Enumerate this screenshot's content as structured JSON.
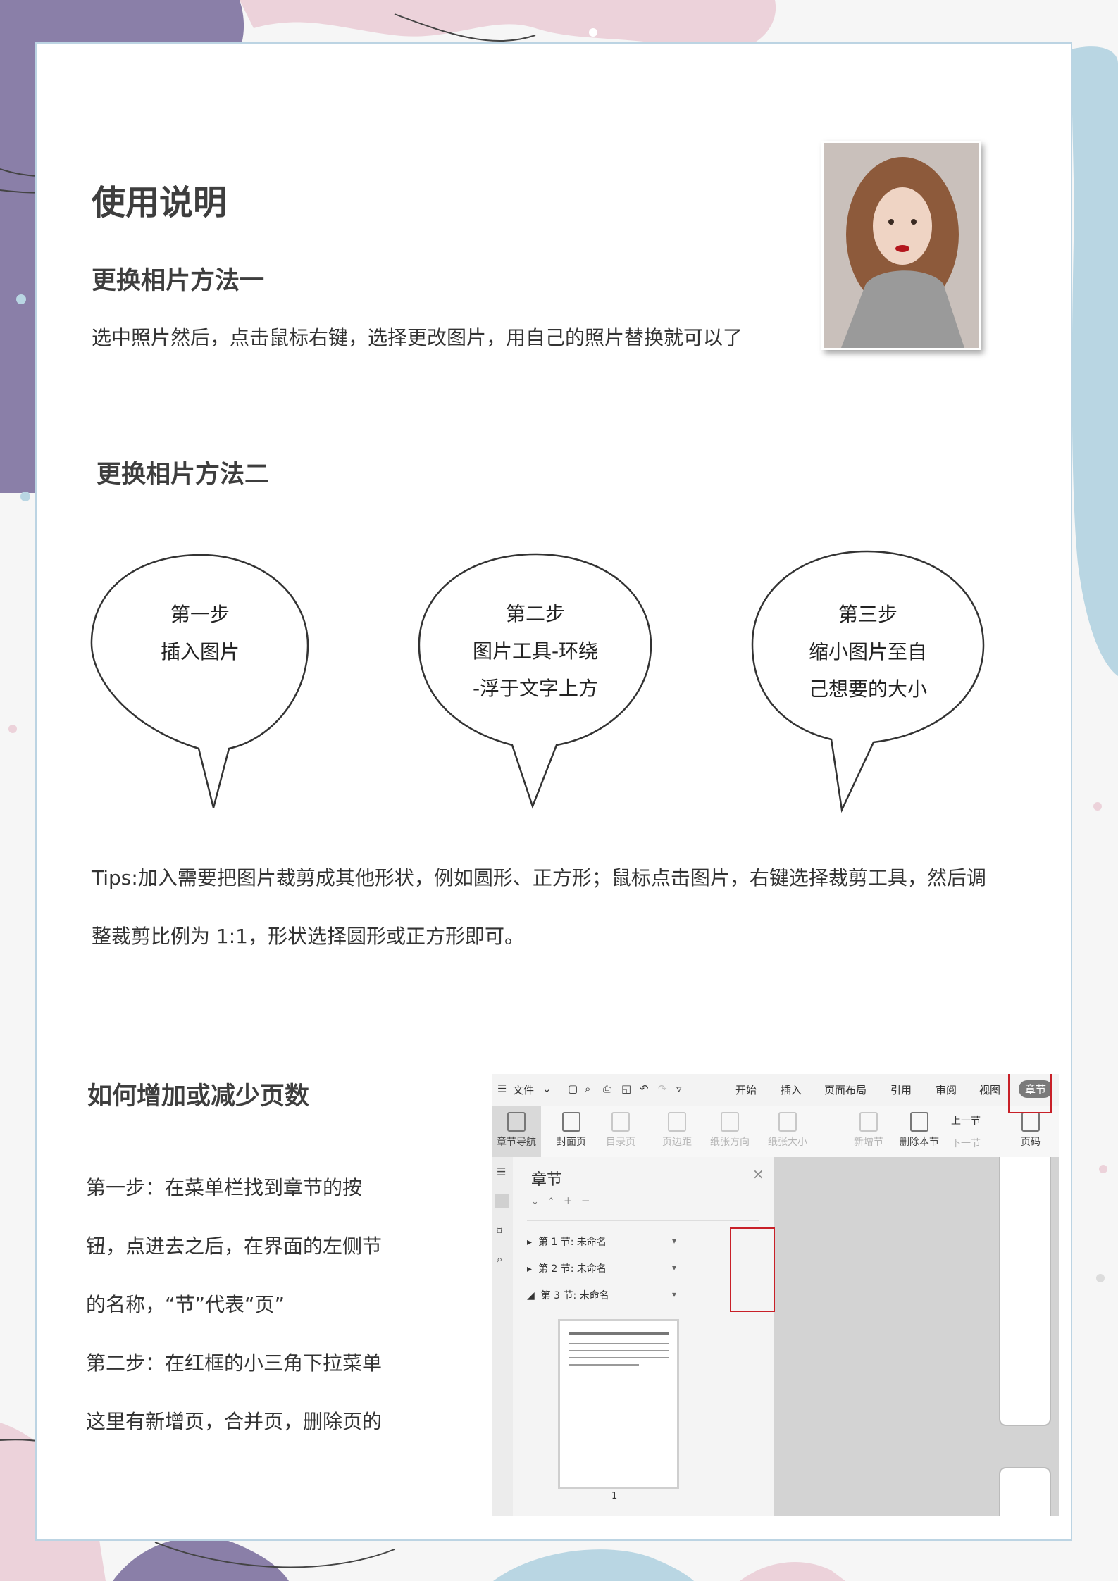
{
  "main": {
    "title": "使用说明",
    "method1_heading": "更换相片方法一",
    "method1_text": "选中照片然后，点击鼠标右键，选择更改图片，用自己的照片替换就可以了",
    "method2_heading": "更换相片方法二",
    "bubbles": [
      {
        "line1": "第一步",
        "line2": "插入图片",
        "line3": ""
      },
      {
        "line1": "第二步",
        "line2": "图片工具-环绕",
        "line3": "-浮于文字上方"
      },
      {
        "line1": "第三步",
        "line2": "缩小图片至自",
        "line3": "己想要的大小"
      }
    ],
    "tips_line1": "Tips:加入需要把图片裁剪成其他形状，例如圆形、正方形；鼠标点击图片，右键选择裁剪工具，然后调",
    "tips_line2": "整裁剪比例为 1:1，形状选择圆形或正方形即可。",
    "pages_heading": "如何增加或减少页数",
    "steps": [
      "第一步：在菜单栏找到章节的按",
      "钮，点进去之后，在界面的左侧节",
      "的名称，“节”代表“页”",
      "第二步：在红框的小三角下拉菜单",
      "这里有新增页，合并页，删除页的"
    ]
  },
  "screenshot": {
    "menu": {
      "file": "文件",
      "tabs": [
        "开始",
        "插入",
        "页面布局",
        "引用",
        "审阅",
        "视图"
      ],
      "active_tab": "章节"
    },
    "ribbon": {
      "section_nav": "章节导航",
      "cover": "封面页",
      "toc": "目录页",
      "margin": "页边距",
      "orientation": "纸张方向",
      "size": "纸张大小",
      "new_section": "新增节",
      "delete_section": "删除本节",
      "prev": "上一节",
      "next": "下一节",
      "page_num": "页码"
    },
    "panel": {
      "title": "章节",
      "sections": [
        "第 1 节: 未命名",
        "第 2 节: 未命名",
        "第 3 节: 未命名"
      ],
      "thumb_page_num": "1"
    }
  },
  "colors": {
    "accent_purple": "#8a7fa8",
    "accent_pink": "#ecd2da",
    "accent_blue": "#b9d6e3",
    "highlight_red": "#c82028"
  }
}
